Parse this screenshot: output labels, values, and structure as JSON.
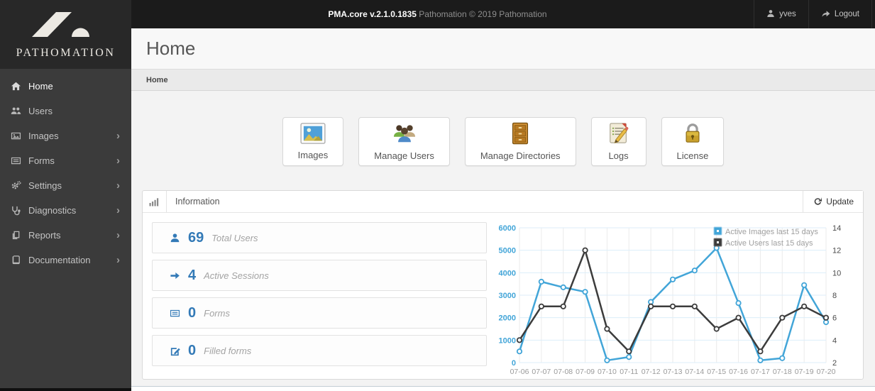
{
  "topbar": {
    "brand_bold": "PMA.core v.2.1.0.1835",
    "brand_rest": "Pathomation © 2019 Pathomation",
    "user": "yves",
    "logout_label": "Logout"
  },
  "logo": {
    "text": "PATHOMATION"
  },
  "sidebar": {
    "items": [
      {
        "label": "Home",
        "submenu": false
      },
      {
        "label": "Users",
        "submenu": false
      },
      {
        "label": "Images",
        "submenu": true
      },
      {
        "label": "Forms",
        "submenu": true
      },
      {
        "label": "Settings",
        "submenu": true
      },
      {
        "label": "Diagnostics",
        "submenu": true
      },
      {
        "label": "Reports",
        "submenu": true
      },
      {
        "label": "Documentation",
        "submenu": true
      }
    ],
    "chevron": "›"
  },
  "page": {
    "title": "Home",
    "breadcrumb": "Home"
  },
  "cards": [
    {
      "label": "Images"
    },
    {
      "label": "Manage Users"
    },
    {
      "label": "Manage Directories"
    },
    {
      "label": "Logs"
    },
    {
      "label": "License"
    }
  ],
  "panel": {
    "title": "Information",
    "update_label": "Update"
  },
  "stats": [
    {
      "value": "69",
      "label": "Total Users"
    },
    {
      "value": "4",
      "label": "Active Sessions"
    },
    {
      "value": "0",
      "label": "Forms"
    },
    {
      "value": "0",
      "label": "Filled forms"
    }
  ],
  "colors": {
    "accent_blue": "#337ab7",
    "chart_blue": "#42a5d8",
    "chart_dark": "#3c3c3c",
    "topbar_bg": "#1b1b1b",
    "sidebar_bg": "#3b3b3b"
  },
  "chart_data": {
    "type": "line",
    "categories": [
      "07-06",
      "07-07",
      "07-08",
      "07-09",
      "07-10",
      "07-11",
      "07-12",
      "07-13",
      "07-14",
      "07-15",
      "07-16",
      "07-17",
      "07-18",
      "07-19",
      "07-20"
    ],
    "series": [
      {
        "name": "Active Images last 15 days",
        "axis": "left",
        "color": "#42a5d8",
        "values": [
          500,
          3600,
          3350,
          3150,
          100,
          250,
          2700,
          3700,
          4100,
          5100,
          2650,
          100,
          200,
          3450,
          1800
        ]
      },
      {
        "name": "Active Users last 15 days",
        "axis": "right",
        "color": "#3c3c3c",
        "values": [
          4,
          7,
          7,
          12,
          5,
          3,
          7,
          7,
          7,
          5,
          6,
          3,
          6,
          7,
          6
        ]
      }
    ],
    "left_axis": {
      "min": 0,
      "max": 6000,
      "step": 1000
    },
    "right_axis": {
      "min": 2,
      "max": 14,
      "step": 2
    },
    "grid": true,
    "legend_position": "top-right",
    "title": "",
    "xlabel": "",
    "ylabel": ""
  }
}
